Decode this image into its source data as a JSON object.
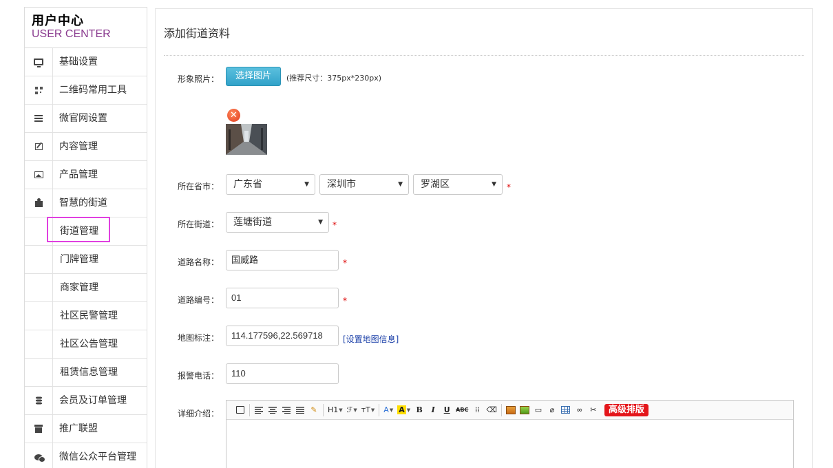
{
  "sidebar": {
    "title": "用户中心",
    "subtitle": "USER CENTER",
    "items": [
      {
        "label": "基础设置",
        "icon": "monitor-icon"
      },
      {
        "label": "二维码常用工具",
        "icon": "qrcode-icon"
      },
      {
        "label": "微官网设置",
        "icon": "list-icon"
      },
      {
        "label": "内容管理",
        "icon": "edit-icon"
      },
      {
        "label": "产品管理",
        "icon": "image-icon"
      },
      {
        "label": "智慧的街道",
        "icon": "puzzle-icon"
      }
    ],
    "subitems": [
      {
        "label": "街道管理"
      },
      {
        "label": "门牌管理"
      },
      {
        "label": "商家管理"
      },
      {
        "label": "社区民警管理"
      },
      {
        "label": "社区公告管理"
      },
      {
        "label": "租赁信息管理"
      }
    ],
    "items_after": [
      {
        "label": "会员及订单管理",
        "icon": "database-icon"
      },
      {
        "label": "推广联盟",
        "icon": "gift-icon"
      },
      {
        "label": "微信公众平台管理",
        "icon": "chat-icon"
      }
    ]
  },
  "main": {
    "title": "添加街道资料",
    "photo": {
      "label": "形象照片：",
      "button": "选择图片",
      "hint": "(推荐尺寸：375px*230px)"
    },
    "province_city": {
      "label": "所在省市：",
      "province": "广东省",
      "city": "深圳市",
      "district": "罗湖区",
      "required": "*"
    },
    "street": {
      "label": "所在街道：",
      "value": "莲塘街道",
      "required": "*"
    },
    "road_name": {
      "label": "道路名称：",
      "value": "国威路",
      "required": "*"
    },
    "road_code": {
      "label": "道路编号：",
      "value": "01",
      "required": "*"
    },
    "map": {
      "label": "地图标注：",
      "value": "114.177596,22.569718",
      "link": "[设置地图信息]"
    },
    "phone": {
      "label": "报警电话：",
      "value": "110"
    },
    "detail": {
      "label": "详细介绍：",
      "toolbar": {
        "h1": "H1",
        "font": "ℱ",
        "size": "тT",
        "color": "A",
        "bg": "A",
        "bold": "B",
        "italic": "I",
        "underline": "U",
        "strike": "ABC",
        "pro": "高级排版"
      }
    }
  }
}
